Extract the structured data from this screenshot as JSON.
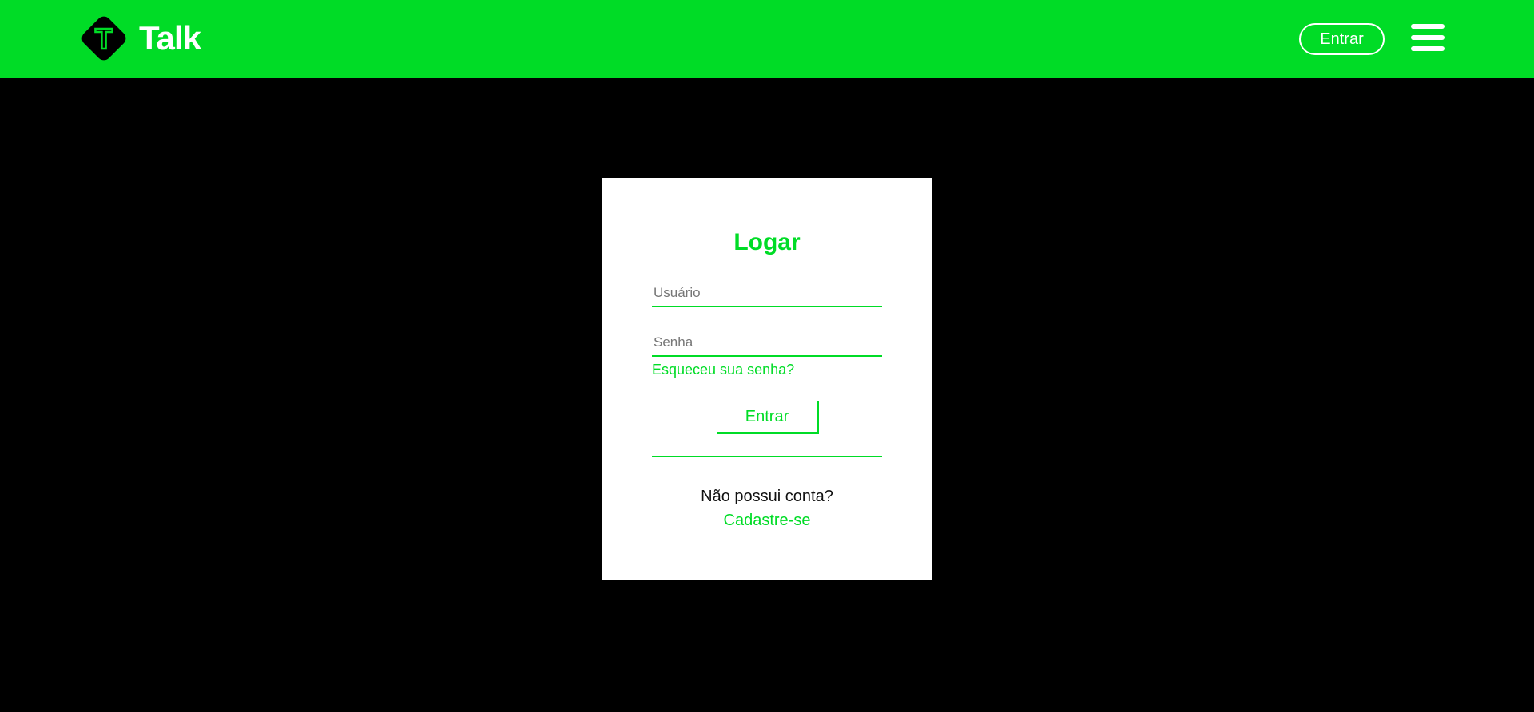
{
  "header": {
    "brand": "Talk",
    "logo_letter": "T",
    "login_label": "Entrar",
    "menu_icon": "hamburger-menu-icon"
  },
  "login_form": {
    "title": "Logar",
    "username_placeholder": "Usuário",
    "username_value": "",
    "password_placeholder": "Senha",
    "password_value": "",
    "forgot_link": "Esqueceu sua senha?",
    "submit_label": "Entrar",
    "no_account_text": "Não possui conta?",
    "signup_link": "Cadastre-se"
  },
  "colors": {
    "brand_green": "#00dc26",
    "background": "#000000",
    "card": "#ffffff",
    "header_text": "#ffffff"
  }
}
